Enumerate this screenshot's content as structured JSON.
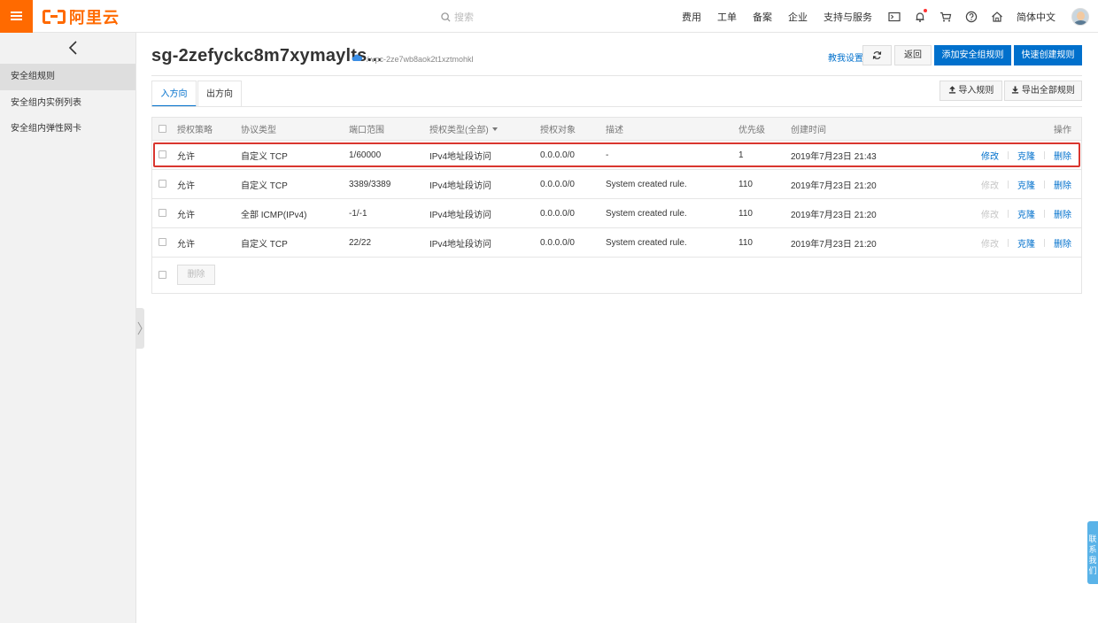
{
  "header": {
    "logo_text": "阿里云",
    "search_placeholder": "搜索",
    "nav_links": [
      "费用",
      "工单",
      "备案",
      "企业",
      "支持与服务"
    ],
    "language": "简体中文"
  },
  "sidebar": {
    "items": [
      {
        "label": "安全组规则",
        "active": true
      },
      {
        "label": "安全组内实例列表",
        "active": false
      },
      {
        "label": "安全组内弹性网卡",
        "active": false
      }
    ]
  },
  "page": {
    "title": "sg-2zefyckc8m7xymaylts...",
    "vpc": "/ vpc-2ze7wb8aok2t1xztmohkl",
    "help_link": "教我设置",
    "back_label": "返回",
    "add_rule_label": "添加安全组规则",
    "quick_create_label": "快速创建规则",
    "import_label": "导入规则",
    "export_label": "导出全部规则"
  },
  "tabs": [
    "入方向",
    "出方向"
  ],
  "table": {
    "columns": [
      "授权策略",
      "协议类型",
      "端口范围",
      "授权类型(全部)",
      "授权对象",
      "描述",
      "优先级",
      "创建时间",
      "操作"
    ],
    "rows": [
      {
        "policy": "允许",
        "protocol": "自定义 TCP",
        "port": "1/60000",
        "auth_type": "IPv4地址段访问",
        "object": "0.0.0.0/0",
        "desc": "-",
        "priority": "1",
        "created": "2019年7月23日 21:43",
        "edit_enabled": true
      },
      {
        "policy": "允许",
        "protocol": "自定义 TCP",
        "port": "3389/3389",
        "auth_type": "IPv4地址段访问",
        "object": "0.0.0.0/0",
        "desc": "System created rule.",
        "priority": "110",
        "created": "2019年7月23日 21:20",
        "edit_enabled": false
      },
      {
        "policy": "允许",
        "protocol": "全部 ICMP(IPv4)",
        "port": "-1/-1",
        "auth_type": "IPv4地址段访问",
        "object": "0.0.0.0/0",
        "desc": "System created rule.",
        "priority": "110",
        "created": "2019年7月23日 21:20",
        "edit_enabled": false
      },
      {
        "policy": "允许",
        "protocol": "自定义 TCP",
        "port": "22/22",
        "auth_type": "IPv4地址段访问",
        "object": "0.0.0.0/0",
        "desc": "System created rule.",
        "priority": "110",
        "created": "2019年7月23日 21:20",
        "edit_enabled": false
      }
    ],
    "op_labels": {
      "edit": "修改",
      "clone": "克隆",
      "delete": "删除"
    },
    "bulk_delete_label": "删除"
  },
  "contact": {
    "label": [
      "联",
      "系",
      "我",
      "们"
    ]
  },
  "colors": {
    "brand": "#ff6a00",
    "primary": "#0070cc",
    "highlight": "#d9362f"
  }
}
